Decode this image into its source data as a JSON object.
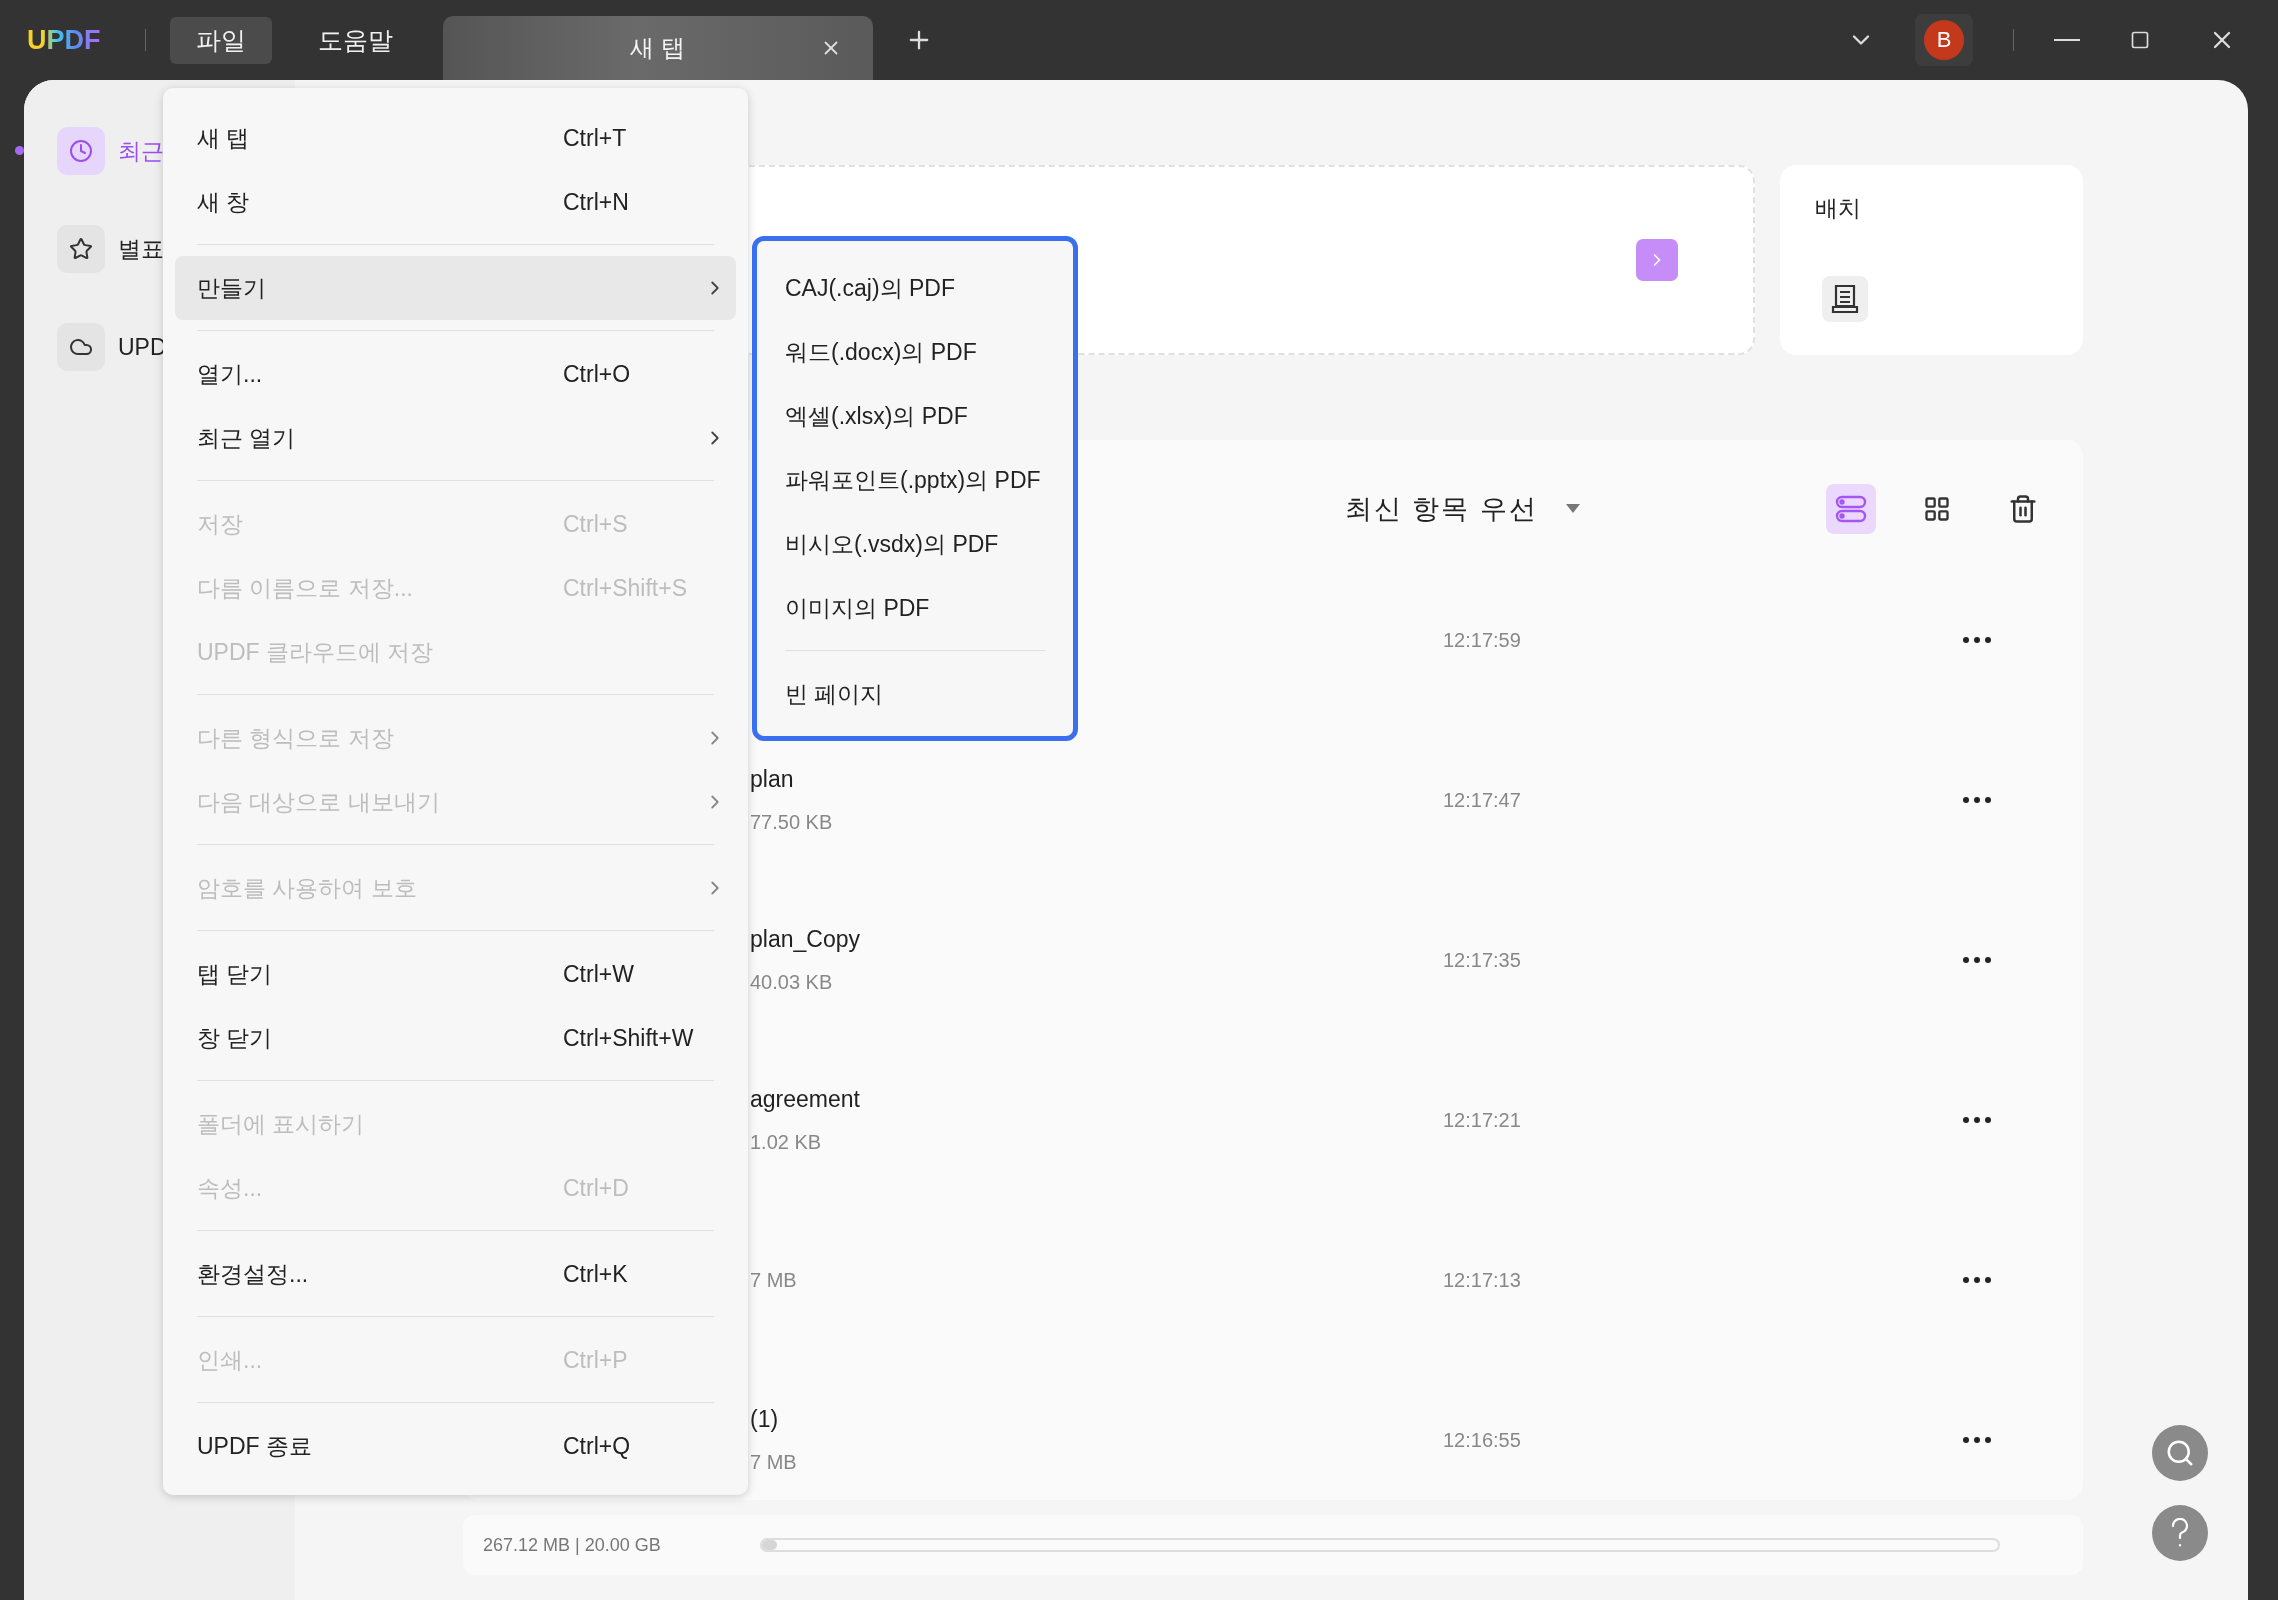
{
  "titlebar": {
    "logo": "UPDF",
    "menus": [
      {
        "label": "파일",
        "selected": true
      },
      {
        "label": "도움말",
        "selected": false
      }
    ],
    "tabs": [
      {
        "label": "새 탭",
        "selected": true
      }
    ],
    "avatar": "B"
  },
  "sidebar": {
    "items": [
      {
        "label": "최근",
        "selected": true
      },
      {
        "label": "별표",
        "selected": false
      },
      {
        "label": "UPD",
        "selected": false
      }
    ]
  },
  "batch_card": {
    "title": "배치"
  },
  "file_list": {
    "sort": "최신 항목 우선",
    "view_modes": [
      {
        "kind": "list",
        "selected": true
      },
      {
        "kind": "grid",
        "selected": false
      }
    ],
    "rows": [
      {
        "time": "12:17:59"
      },
      {
        "name": "plan",
        "size": "77.50 KB",
        "time": "12:17:47"
      },
      {
        "name": "plan_Copy",
        "size": "40.03 KB",
        "time": "12:17:35"
      },
      {
        "name": "agreement",
        "size": "1.02 KB",
        "time": "12:17:21"
      },
      {
        "size": "7 MB",
        "time": "12:17:13"
      },
      {
        "name": "(1)",
        "size": "7 MB",
        "time": "12:16:55"
      }
    ]
  },
  "storage": {
    "reading": "267.12 MB | 20.00 GB",
    "level": 0.012
  },
  "file_menu": {
    "groups": [
      [
        {
          "label": "새 탭",
          "shortcut": "Ctrl+T",
          "disabled": false,
          "submenu": false,
          "selected": false
        },
        {
          "label": "새 창",
          "shortcut": "Ctrl+N",
          "disabled": false,
          "submenu": false,
          "selected": false
        }
      ],
      [
        {
          "label": "만들기",
          "disabled": false,
          "submenu": true,
          "selected": true
        }
      ],
      [
        {
          "label": "열기...",
          "shortcut": "Ctrl+O",
          "disabled": false,
          "submenu": false,
          "selected": false
        },
        {
          "label": "최근 열기",
          "disabled": false,
          "submenu": true,
          "selected": false
        }
      ],
      [
        {
          "label": "저장",
          "shortcut": "Ctrl+S",
          "disabled": true,
          "submenu": false,
          "selected": false
        },
        {
          "label": "다름 이름으로 저장...",
          "shortcut": "Ctrl+Shift+S",
          "disabled": true,
          "submenu": false,
          "selected": false
        },
        {
          "label": "UPDF 클라우드에 저장",
          "disabled": true,
          "submenu": false,
          "selected": false
        }
      ],
      [
        {
          "label": "다른 형식으로 저장",
          "disabled": true,
          "submenu": true,
          "selected": false
        },
        {
          "label": "다음 대상으로 내보내기",
          "disabled": true,
          "submenu": true,
          "selected": false
        }
      ],
      [
        {
          "label": "암호를 사용하여 보호",
          "disabled": true,
          "submenu": true,
          "selected": false
        }
      ],
      [
        {
          "label": "탭 닫기",
          "shortcut": "Ctrl+W",
          "disabled": false,
          "submenu": false,
          "selected": false
        },
        {
          "label": "창 닫기",
          "shortcut": "Ctrl+Shift+W",
          "disabled": false,
          "submenu": false,
          "selected": false
        }
      ],
      [
        {
          "label": "폴더에 표시하기",
          "disabled": true,
          "submenu": false,
          "selected": false
        },
        {
          "label": "속성...",
          "shortcut": "Ctrl+D",
          "disabled": true,
          "submenu": false,
          "selected": false
        }
      ],
      [
        {
          "label": "환경설정...",
          "shortcut": "Ctrl+K",
          "disabled": false,
          "submenu": false,
          "selected": false
        }
      ],
      [
        {
          "label": "인쇄...",
          "shortcut": "Ctrl+P",
          "disabled": true,
          "submenu": false,
          "selected": false
        }
      ],
      [
        {
          "label": "UPDF 종료",
          "shortcut": "Ctrl+Q",
          "disabled": false,
          "submenu": false,
          "selected": false
        }
      ]
    ]
  },
  "create_submenu": {
    "groups": [
      [
        "CAJ(.caj)의 PDF",
        "워드(.docx)의 PDF",
        "엑셀(.xlsx)의 PDF",
        "파워포인트(.pptx)의 PDF",
        "비시오(.vsdx)의 PDF",
        "이미지의 PDF"
      ],
      [
        "빈 페이지"
      ]
    ]
  }
}
